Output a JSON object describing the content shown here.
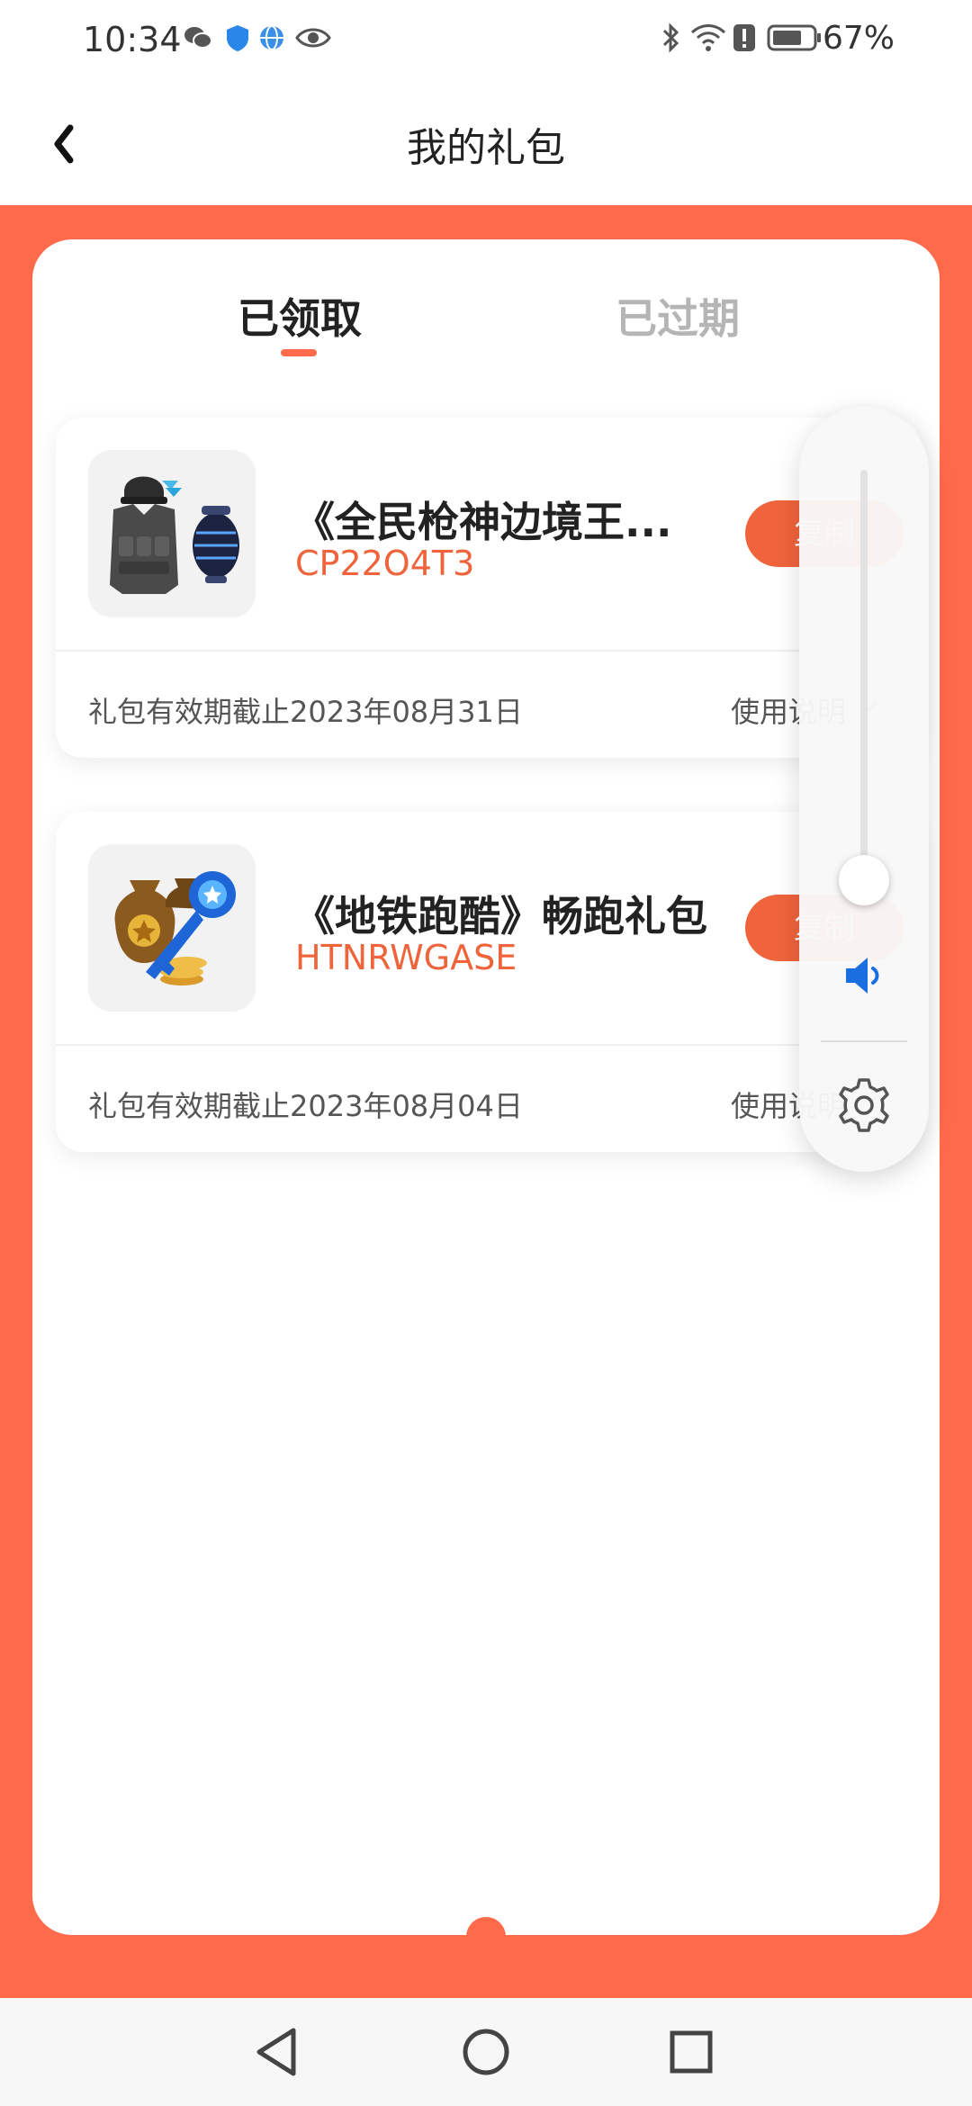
{
  "status_bar": {
    "time": "10:34",
    "battery": "67%",
    "left_icons": [
      "wechat-icon",
      "shield-icon",
      "browser-icon",
      "eye-icon"
    ],
    "right_icons": [
      "bluetooth-icon",
      "wifi-icon",
      "alert-icon",
      "battery-icon"
    ]
  },
  "header": {
    "title": "我的礼包",
    "back_icon": "chevron-left-icon"
  },
  "tabs": [
    {
      "label": "已领取",
      "active": true
    },
    {
      "label": "已过期",
      "active": false
    }
  ],
  "gifts": [
    {
      "title": "《全民枪神边境王...",
      "code": "CP22O4T3",
      "copy_label": "复制",
      "expiry": "礼包有效期截止2023年08月31日",
      "usage_label": "使用说明",
      "thumbnail": "armor-vest-icon"
    },
    {
      "title": "《地铁跑酷》畅跑礼包",
      "code": "HTNRWGASE",
      "copy_label": "复制",
      "expiry": "礼包有效期截止2023年08月04日",
      "usage_label": "使用说明",
      "thumbnail": "coin-bag-key-icon"
    }
  ],
  "volume_panel": {
    "level": 0.05,
    "icons": [
      "speaker-icon",
      "gear-icon"
    ]
  },
  "nav_bar": {
    "buttons": [
      "back-triangle-icon",
      "home-circle-icon",
      "recents-square-icon"
    ]
  },
  "colors": {
    "accent": "#ff6a4a",
    "code_text": "#f0643c",
    "volume_blue": "#1a6ee0"
  }
}
